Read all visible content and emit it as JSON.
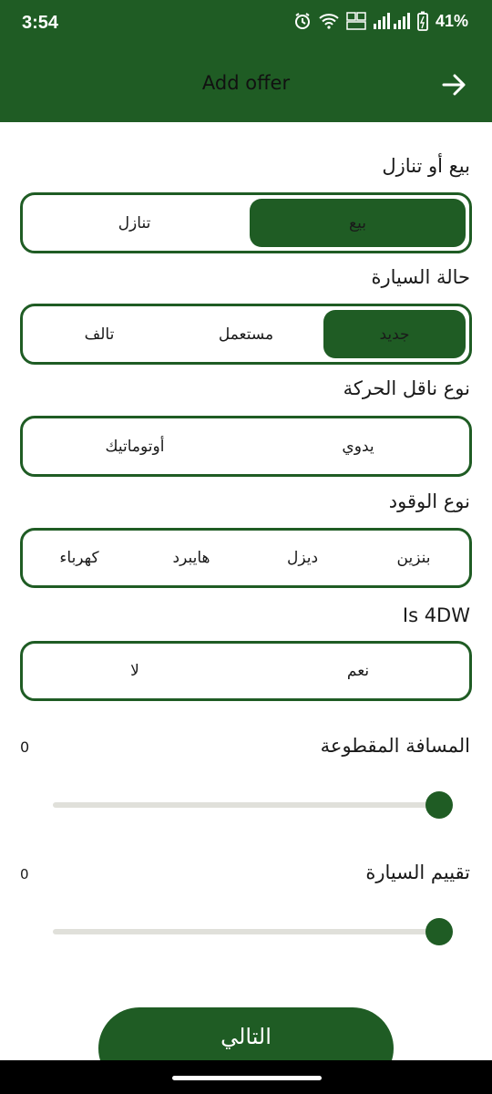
{
  "status_bar": {
    "time": "3:54",
    "battery": "41%",
    "icons": [
      "alarm-icon",
      "wifi-icon",
      "volte-icon",
      "signal-icon",
      "battery-icon"
    ]
  },
  "app_bar": {
    "title": "Add offer",
    "back_icon": "arrow-right-icon"
  },
  "sections": {
    "sale_type": {
      "label": "بيع أو تنازل",
      "options": [
        "بيع",
        "تنازل"
      ],
      "selected": "بيع"
    },
    "condition": {
      "label": "حالة السيارة",
      "options": [
        "جديد",
        "مستعمل",
        "تالف"
      ],
      "selected": "جديد"
    },
    "transmission": {
      "label": "نوع ناقل الحركة",
      "options": [
        "يدوي",
        "أوتوماتيك"
      ],
      "selected": ""
    },
    "fuel": {
      "label": "نوع الوقود",
      "options": [
        "بنزين",
        "ديزل",
        "هايبرد",
        "كهرباء"
      ],
      "selected": ""
    },
    "four_wd": {
      "label": "Is 4DW",
      "options": [
        "نعم",
        "لا"
      ],
      "selected": ""
    }
  },
  "sliders": {
    "mileage": {
      "label": "المسافة المقطوعة",
      "value": "0"
    },
    "rating": {
      "label": "تقييم السيارة",
      "value": "0"
    }
  },
  "next_button": {
    "label": "التالي"
  },
  "colors": {
    "primary": "#1f5c24",
    "track": "#e0e0da"
  }
}
